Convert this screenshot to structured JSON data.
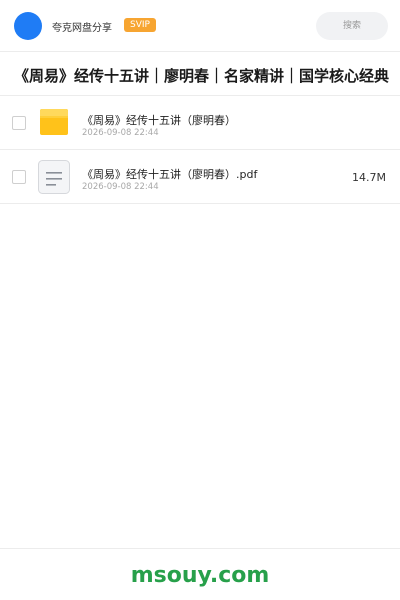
{
  "header": {
    "app_name": "夸克网盘分享",
    "badge": "SVIP",
    "search_placeholder": "搜索",
    "accent_color": "#1f7cf5",
    "badge_color": "#f7a531"
  },
  "title": "《周易》经传十五讲｜廖明春｜名家精讲｜国学核心经典",
  "files": [
    {
      "type": "folder",
      "icon": "folder-icon",
      "name": "《周易》经传十五讲（廖明春）",
      "date": "2026-09-08 22:44",
      "size": ""
    },
    {
      "type": "document",
      "icon": "document-icon",
      "name": "《周易》经传十五讲（廖明春）.pdf",
      "date": "2026-09-08 22:44",
      "size": "14.7M"
    }
  ],
  "footer": {
    "brand": "msouy.com",
    "brand_color": "#27a04a"
  }
}
